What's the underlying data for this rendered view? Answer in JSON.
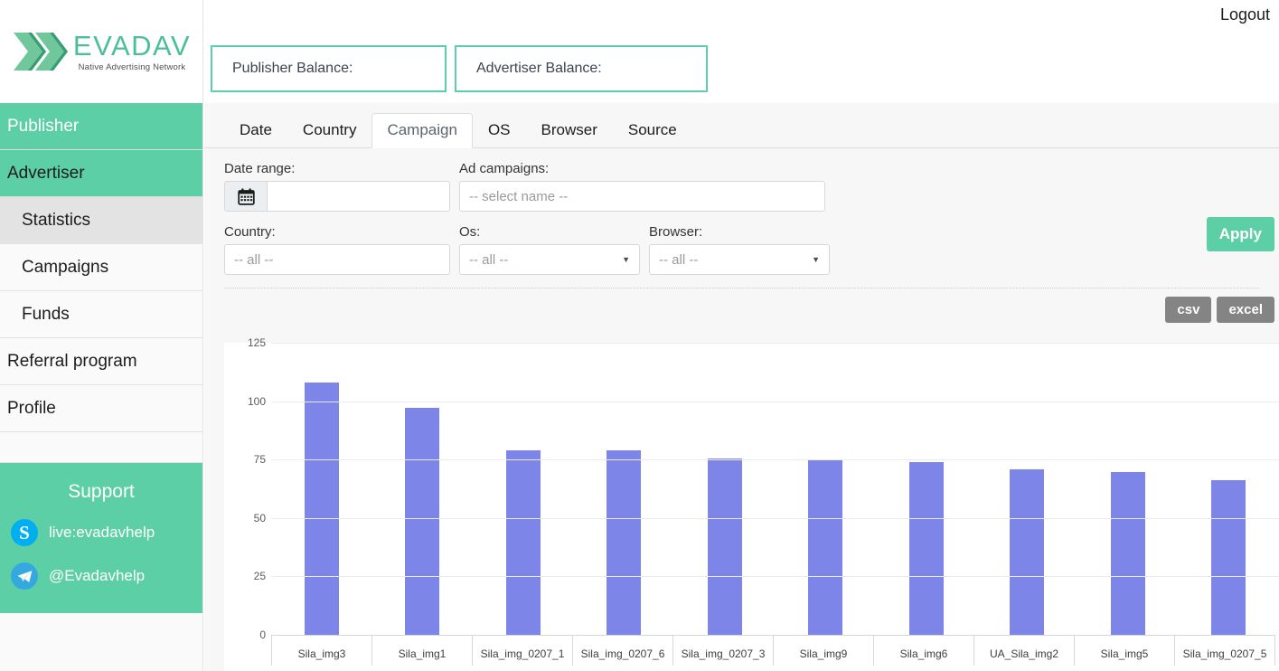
{
  "brand": {
    "name": "EVADAV",
    "tagline": "Native Advertising Network",
    "accent": "#5ccfa7",
    "logo_green_dark": "#3a9c73",
    "logo_green_light": "#6fc79b"
  },
  "topbar": {
    "logout_label": "Logout"
  },
  "balances": [
    {
      "label": "Publisher Balance:",
      "value": ""
    },
    {
      "label": "Advertiser Balance:",
      "value": ""
    }
  ],
  "sidebar": {
    "main_items": [
      {
        "label": "Publisher",
        "name": "publisher"
      },
      {
        "label": "Advertiser",
        "name": "advertiser"
      }
    ],
    "sub_items": [
      {
        "label": "Statistics",
        "name": "statistics",
        "active": true
      },
      {
        "label": "Campaigns",
        "name": "campaigns",
        "active": false
      },
      {
        "label": "Funds",
        "name": "funds",
        "active": false
      },
      {
        "label": "Referral program",
        "name": "referral-program",
        "active": false
      },
      {
        "label": "Profile",
        "name": "profile",
        "active": false
      }
    ],
    "support": {
      "title": "Support",
      "skype_icon": "skype-icon",
      "skype_label": "live:evadavhelp",
      "telegram_icon": "telegram-icon",
      "telegram_label": "@Evadavhelp"
    }
  },
  "tabs": [
    {
      "label": "Date",
      "name": "date",
      "active": false
    },
    {
      "label": "Country",
      "name": "country",
      "active": false
    },
    {
      "label": "Campaign",
      "name": "campaign",
      "active": true
    },
    {
      "label": "OS",
      "name": "os",
      "active": false
    },
    {
      "label": "Browser",
      "name": "browser",
      "active": false
    },
    {
      "label": "Source",
      "name": "source",
      "active": false
    }
  ],
  "filters": {
    "date_range_label": "Date range:",
    "date_range_value": "",
    "date_range_placeholder": "",
    "calendar_icon": "calendar-icon",
    "ad_campaigns_label": "Ad campaigns:",
    "ad_campaigns_value": "-- select name --",
    "country_label": "Country:",
    "country_value": "-- all --",
    "os_label": "Os:",
    "os_value": "-- all --",
    "browser_label": "Browser:",
    "browser_value": "-- all --",
    "apply_label": "Apply",
    "caret_icon": "chevron-down-icon"
  },
  "export": {
    "csv_label": "csv",
    "excel_label": "excel"
  },
  "chart_data": {
    "type": "bar",
    "title": "",
    "xlabel": "",
    "ylabel": "",
    "ylim": [
      0,
      125
    ],
    "yticks": [
      0,
      25,
      50,
      75,
      100,
      125
    ],
    "grid": true,
    "legend": "none",
    "bar_color": "#7d85e8",
    "categories": [
      "Sila_img3",
      "Sila_img1",
      "Sila_img_0207_1",
      "Sila_img_0207_6",
      "Sila_img_0207_3",
      "Sila_img9",
      "Sila_img6",
      "UA_Sila_img2",
      "Sila_img5",
      "Sila_img_0207_5"
    ],
    "values": [
      108,
      97,
      79,
      79,
      75.5,
      75,
      74,
      71,
      69.5,
      66
    ]
  }
}
